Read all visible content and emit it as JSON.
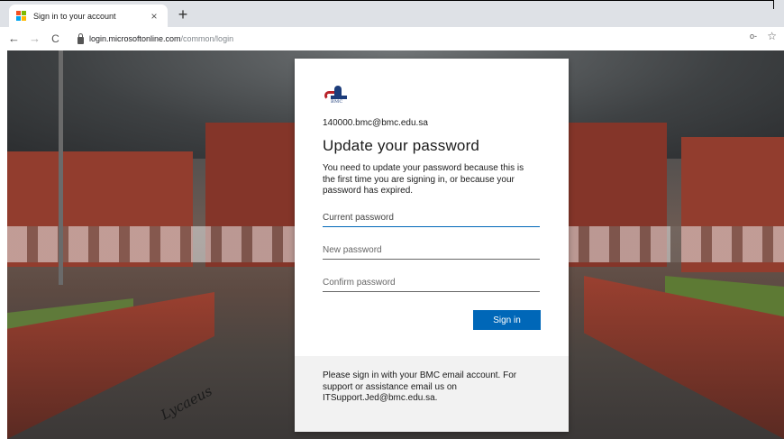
{
  "browser": {
    "tab_title": "Sign in to your account",
    "tab_close": "×",
    "new_tab": "+",
    "back": "←",
    "forward": "→",
    "reload": "C",
    "url_host": "login.microsoftonline.com",
    "url_path": "/common/login",
    "key_icon": "o-",
    "star_icon": "☆"
  },
  "card": {
    "logo_text": "BMC",
    "email": "140000.bmc@bmc.edu.sa",
    "heading": "Update your password",
    "description": "You need to update your password because this is the first time you are signing in, or because your password has expired.",
    "fields": {
      "current_placeholder": "Current password",
      "new_placeholder": "New password",
      "confirm_placeholder": "Confirm password"
    },
    "signin_label": "Sign in",
    "footer_text": "Please sign in with your BMC email account. For support or assistance email us on ITSupport.Jed@bmc.edu.sa."
  },
  "background": {
    "signature": "Lycaeus"
  },
  "colors": {
    "accent": "#0067b8",
    "brand_red": "#b8232a",
    "brand_blue": "#1c3c7a"
  }
}
